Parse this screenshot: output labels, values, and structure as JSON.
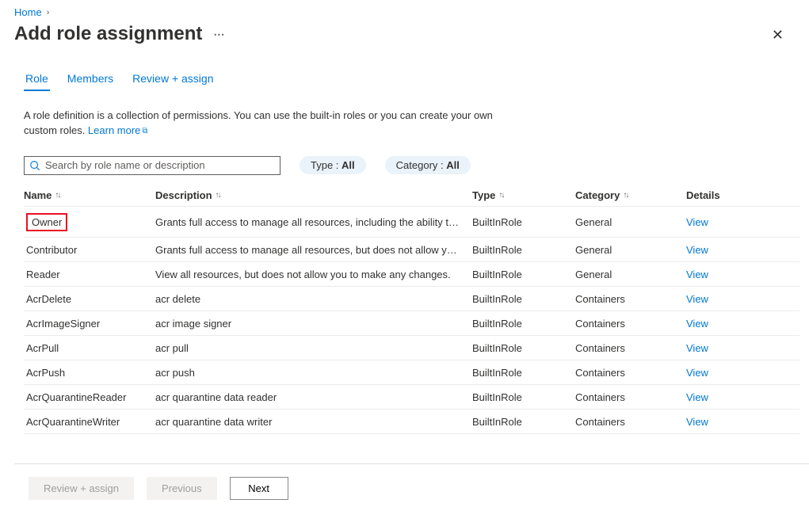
{
  "breadcrumb": {
    "home": "Home"
  },
  "page_title": "Add role assignment",
  "tabs": {
    "role": "Role",
    "members": "Members",
    "review": "Review + assign"
  },
  "description": "A role definition is a collection of permissions. You can use the built-in roles or you can create your own custom roles. ",
  "learn_more": "Learn more",
  "search": {
    "placeholder": "Search by role name or description"
  },
  "filters": {
    "type_label": "Type : ",
    "type_value": "All",
    "category_label": "Category : ",
    "category_value": "All"
  },
  "columns": {
    "name": "Name",
    "description": "Description",
    "type": "Type",
    "category": "Category",
    "details": "Details"
  },
  "view_label": "View",
  "rows": [
    {
      "name": "Owner",
      "description": "Grants full access to manage all resources, including the ability to a…",
      "type": "BuiltInRole",
      "category": "General",
      "highlighted": true
    },
    {
      "name": "Contributor",
      "description": "Grants full access to manage all resources, but does not allow you …",
      "type": "BuiltInRole",
      "category": "General"
    },
    {
      "name": "Reader",
      "description": "View all resources, but does not allow you to make any changes.",
      "type": "BuiltInRole",
      "category": "General"
    },
    {
      "name": "AcrDelete",
      "description": "acr delete",
      "type": "BuiltInRole",
      "category": "Containers"
    },
    {
      "name": "AcrImageSigner",
      "description": "acr image signer",
      "type": "BuiltInRole",
      "category": "Containers"
    },
    {
      "name": "AcrPull",
      "description": "acr pull",
      "type": "BuiltInRole",
      "category": "Containers"
    },
    {
      "name": "AcrPush",
      "description": "acr push",
      "type": "BuiltInRole",
      "category": "Containers"
    },
    {
      "name": "AcrQuarantineReader",
      "description": "acr quarantine data reader",
      "type": "BuiltInRole",
      "category": "Containers"
    },
    {
      "name": "AcrQuarantineWriter",
      "description": "acr quarantine data writer",
      "type": "BuiltInRole",
      "category": "Containers"
    }
  ],
  "footer": {
    "review": "Review + assign",
    "previous": "Previous",
    "next": "Next"
  }
}
